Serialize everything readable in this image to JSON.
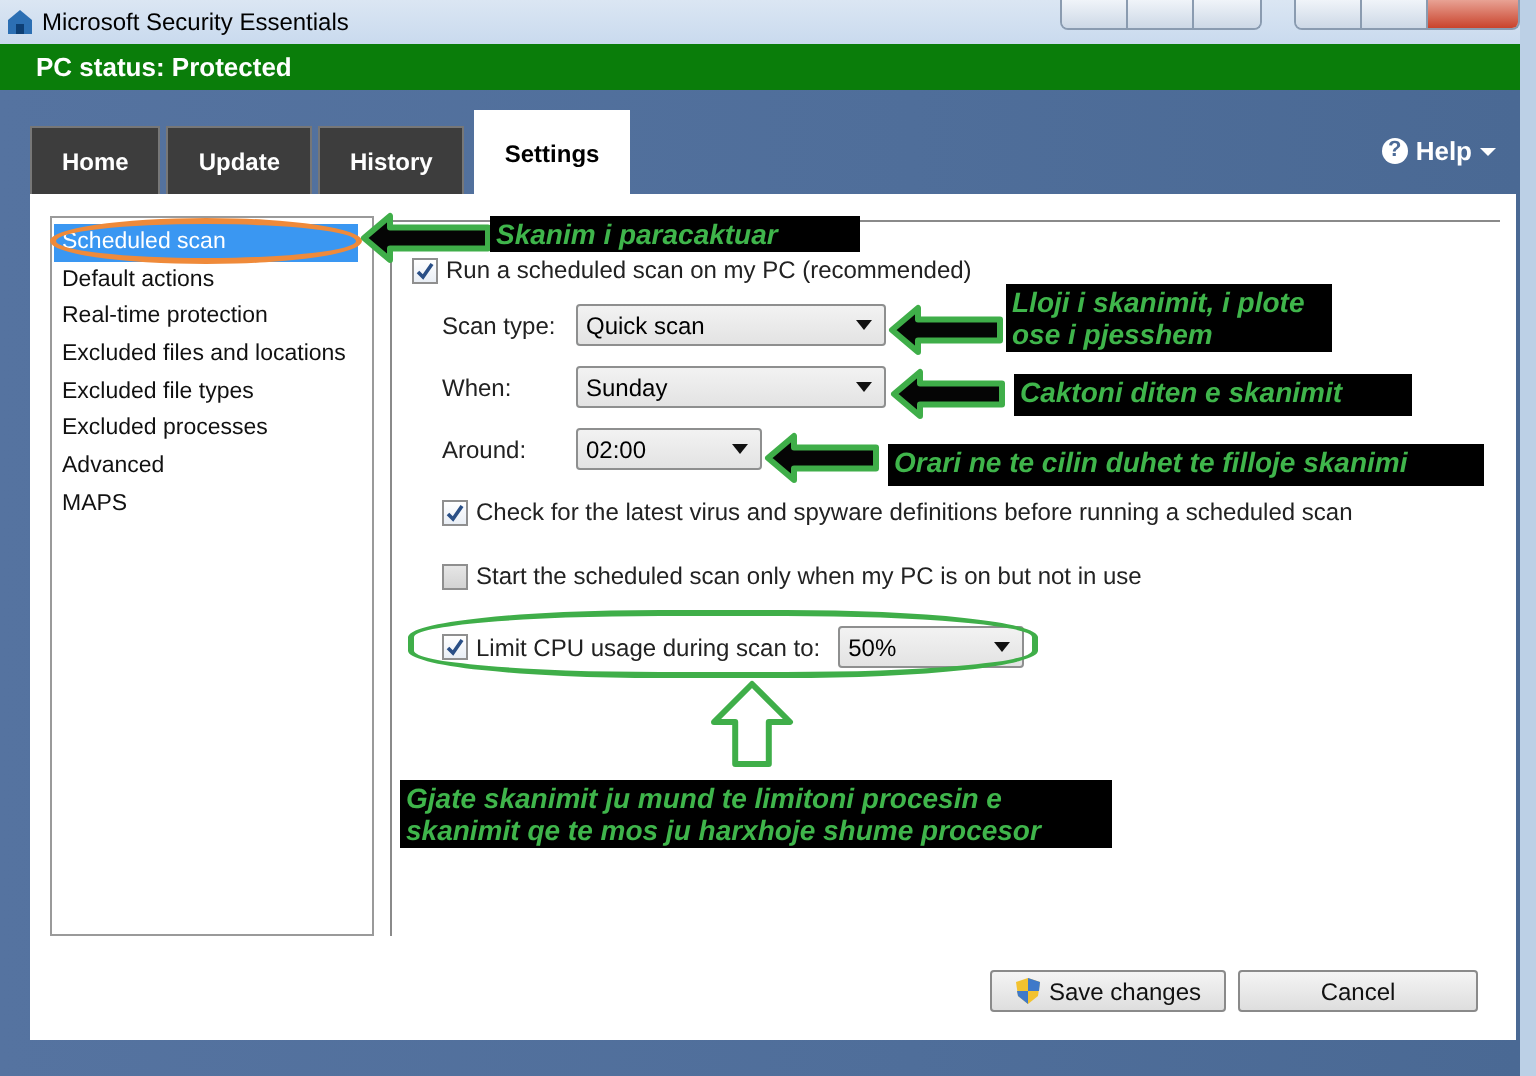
{
  "window": {
    "title": "Microsoft Security Essentials"
  },
  "status_bar": {
    "text": "PC status: Protected"
  },
  "tabs": [
    {
      "label": "Home",
      "selected": false
    },
    {
      "label": "Update",
      "selected": false
    },
    {
      "label": "History",
      "selected": false
    },
    {
      "label": "Settings",
      "selected": true
    }
  ],
  "help": {
    "icon": "?",
    "label": "Help"
  },
  "sidebar": {
    "items": [
      {
        "label": "Scheduled scan",
        "selected": true
      },
      {
        "label": "Default actions",
        "selected": false
      },
      {
        "label": "Real-time protection",
        "selected": false
      },
      {
        "label": "Excluded files and locations",
        "selected": false
      },
      {
        "label": "Excluded file types",
        "selected": false
      },
      {
        "label": "Excluded processes",
        "selected": false
      },
      {
        "label": "Advanced",
        "selected": false
      },
      {
        "label": "MAPS",
        "selected": false
      }
    ]
  },
  "settings": {
    "run_scheduled": {
      "label": "Run a scheduled scan on my PC (recommended)",
      "checked": true
    },
    "fields": [
      {
        "label": "Scan type:",
        "value": "Quick scan",
        "kind": "wide"
      },
      {
        "label": "When:",
        "value": "Sunday",
        "kind": "wide"
      },
      {
        "label": "Around:",
        "value": "02:00",
        "kind": "narrow"
      }
    ],
    "options": [
      {
        "label": "Check for the latest virus and spyware definitions before running a scheduled scan",
        "checked": true,
        "kind": "plain"
      },
      {
        "label": "Start the scheduled scan only when my PC is on but not in use",
        "checked": false,
        "kind": "plain"
      },
      {
        "label": "Limit CPU usage during scan to:",
        "checked": true,
        "kind": "dropdown",
        "value": "50%"
      }
    ]
  },
  "buttons": [
    {
      "label": "Save changes",
      "kind": "admin"
    },
    {
      "label": "Cancel",
      "kind": "plain"
    }
  ],
  "annotations": [
    {
      "text": "Skanim i paracaktuar",
      "kind": "left"
    },
    {
      "text": "Lloji i skanimit, i plote ose i pjesshem",
      "kind": "left"
    },
    {
      "text": "Caktoni diten e skanimit",
      "kind": "left"
    },
    {
      "text": "Orari ne te cilin duhet te filloje skanimi",
      "kind": "left"
    },
    {
      "text": "Gjate skanimit ju mund te limitoni procesin e skanimit qe te mos ju harxhoje shume procesor",
      "kind": "up"
    }
  ]
}
